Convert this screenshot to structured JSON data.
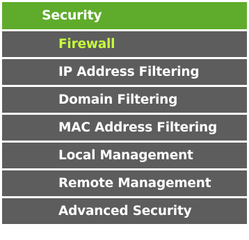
{
  "menu": {
    "section_title": "Security",
    "items": [
      {
        "label": "Firewall",
        "active": true
      },
      {
        "label": "IP Address Filtering",
        "active": false
      },
      {
        "label": "Domain Filtering",
        "active": false
      },
      {
        "label": "MAC Address Filtering",
        "active": false
      },
      {
        "label": "Local Management",
        "active": false
      },
      {
        "label": "Remote Management",
        "active": false
      },
      {
        "label": "Advanced Security",
        "active": false
      }
    ]
  },
  "colors": {
    "header_bg": "#5fac2c",
    "item_bg": "#5d5d5d",
    "item_text": "#ffffff",
    "active_text": "#c6ff3b"
  }
}
